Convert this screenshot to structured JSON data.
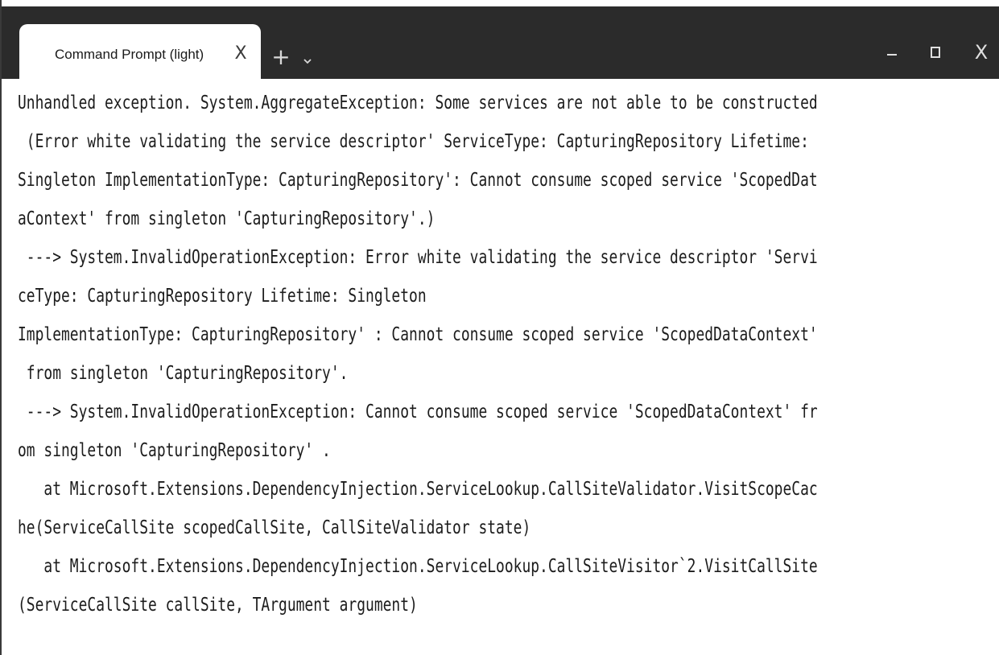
{
  "tab": {
    "title": "Command Prompt (light)",
    "close_label": "X"
  },
  "toolbar": {
    "new_tab_label": "+",
    "dropdown_icon": "chevron-down-icon"
  },
  "window_controls": {
    "minimize_icon": "minimize-icon",
    "maximize_icon": "maximize-icon",
    "close_label": "X"
  },
  "terminal": {
    "lines": [
      "Unhandled exception. System.AggregateException: Some services are not able to be constructed",
      " (Error white validating the service descriptor' ServiceType: CapturingRepository Lifetime:",
      "Singleton ImplementationType: CapturingRepository': Cannot consume scoped service 'ScopedDat",
      "aContext' from singleton 'CapturingRepository'.)",
      " ---> System.InvalidOperationException: Error white validating the service descriptor 'Servi",
      "ceType: CapturingRepository Lifetime: Singleton",
      "ImplementationType: CapturingRepository' : Cannot consume scoped service 'ScopedDataContext'",
      " from singleton 'CapturingRepository'.",
      " ---> System.InvalidOperationException: Cannot consume scoped service 'ScopedDataContext' fr",
      "om singleton 'CapturingRepository' .",
      "   at Microsoft.Extensions.DependencyInjection.ServiceLookup.CallSiteValidator.VisitScopeCac",
      "he(ServiceCallSite scopedCallSite, CallSiteValidator state)",
      "   at Microsoft.Extensions.DependencyInjection.ServiceLookup.CallSiteVisitor`2.VisitCallSite",
      "(ServiceCallSite callSite, TArgument argument)"
    ]
  },
  "colors": {
    "titlebar": "#2b2b2b",
    "tab_background": "#ffffff",
    "terminal_background": "#ffffff",
    "terminal_text": "#1c1c1c"
  }
}
